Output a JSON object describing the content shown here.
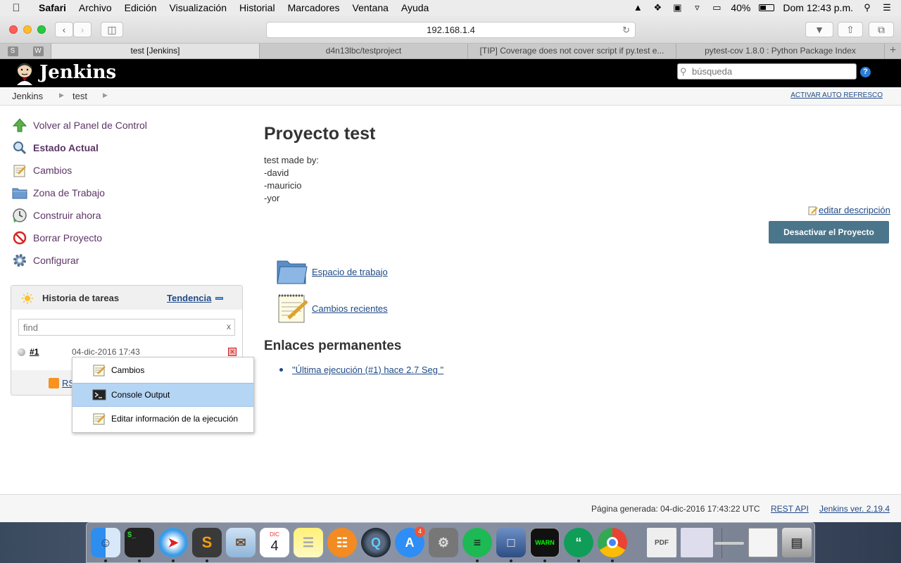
{
  "menubar": {
    "app": "Safari",
    "items": [
      "Archivo",
      "Edición",
      "Visualización",
      "Historial",
      "Marcadores",
      "Ventana",
      "Ayuda"
    ],
    "battery": "40%",
    "clock": "Dom 12:43 p.m."
  },
  "browser": {
    "url": "192.168.1.4",
    "pinned": [
      "S",
      "W"
    ],
    "tabs": [
      "test [Jenkins]",
      "d4n13lbc/testproject",
      "[TIP] Coverage does not cover script if py.test e...",
      "pytest-cov 1.8.0 : Python Package Index"
    ]
  },
  "header": {
    "title": "Jenkins",
    "search_placeholder": "búsqueda",
    "help": "?"
  },
  "breadcrumb": {
    "items": [
      "Jenkins",
      "test"
    ],
    "autorefresh": "ACTIVAR AUTO REFRESCO"
  },
  "sidebar": {
    "items": [
      {
        "label": "Volver al Panel de Control",
        "icon": "up-arrow-icon"
      },
      {
        "label": "Estado Actual",
        "icon": "magnifier-icon"
      },
      {
        "label": "Cambios",
        "icon": "notepad-icon"
      },
      {
        "label": "Zona de Trabajo",
        "icon": "folder-icon"
      },
      {
        "label": "Construir ahora",
        "icon": "clock-build-icon"
      },
      {
        "label": "Borrar Proyecto",
        "icon": "no-entry-icon"
      },
      {
        "label": "Configurar",
        "icon": "gear-icon"
      }
    ]
  },
  "history": {
    "title": "Historia de tareas",
    "trend": "Tendencia",
    "find_placeholder": "find",
    "clear": "x",
    "builds": [
      {
        "number": "#1",
        "date": "04-dic-2016 17:43"
      }
    ],
    "rss_label": "RS"
  },
  "context_menu": {
    "items": [
      {
        "label": "Cambios",
        "icon": "notepad-icon"
      },
      {
        "label": "Console Output",
        "icon": "terminal-icon"
      },
      {
        "label": "Editar información de la ejecución",
        "icon": "notepad-icon"
      }
    ],
    "highlighted": "Console Output"
  },
  "main": {
    "title": "Proyecto test",
    "description": [
      "test made by:",
      "-david",
      "-mauricio",
      "-yor"
    ],
    "edit_description": "editar descripción",
    "disable_button": "Desactivar el Proyecto",
    "links": [
      {
        "label": "Espacio de trabajo",
        "icon": "folder-icon"
      },
      {
        "label": "Cambios recientes",
        "icon": "notepad-icon"
      }
    ],
    "permalinks_title": "Enlaces permanentes",
    "permalinks": [
      "\"Última ejecución (#1) hace 2.7 Seg \""
    ]
  },
  "footer": {
    "generated": "Página generada: 04-dic-2016 17:43:22 UTC",
    "rest_api": "REST API",
    "version": "Jenkins ver. 2.19.4"
  },
  "dock": {
    "calendar_month": "DIC",
    "calendar_day": "4",
    "appstore_badge": "4"
  }
}
